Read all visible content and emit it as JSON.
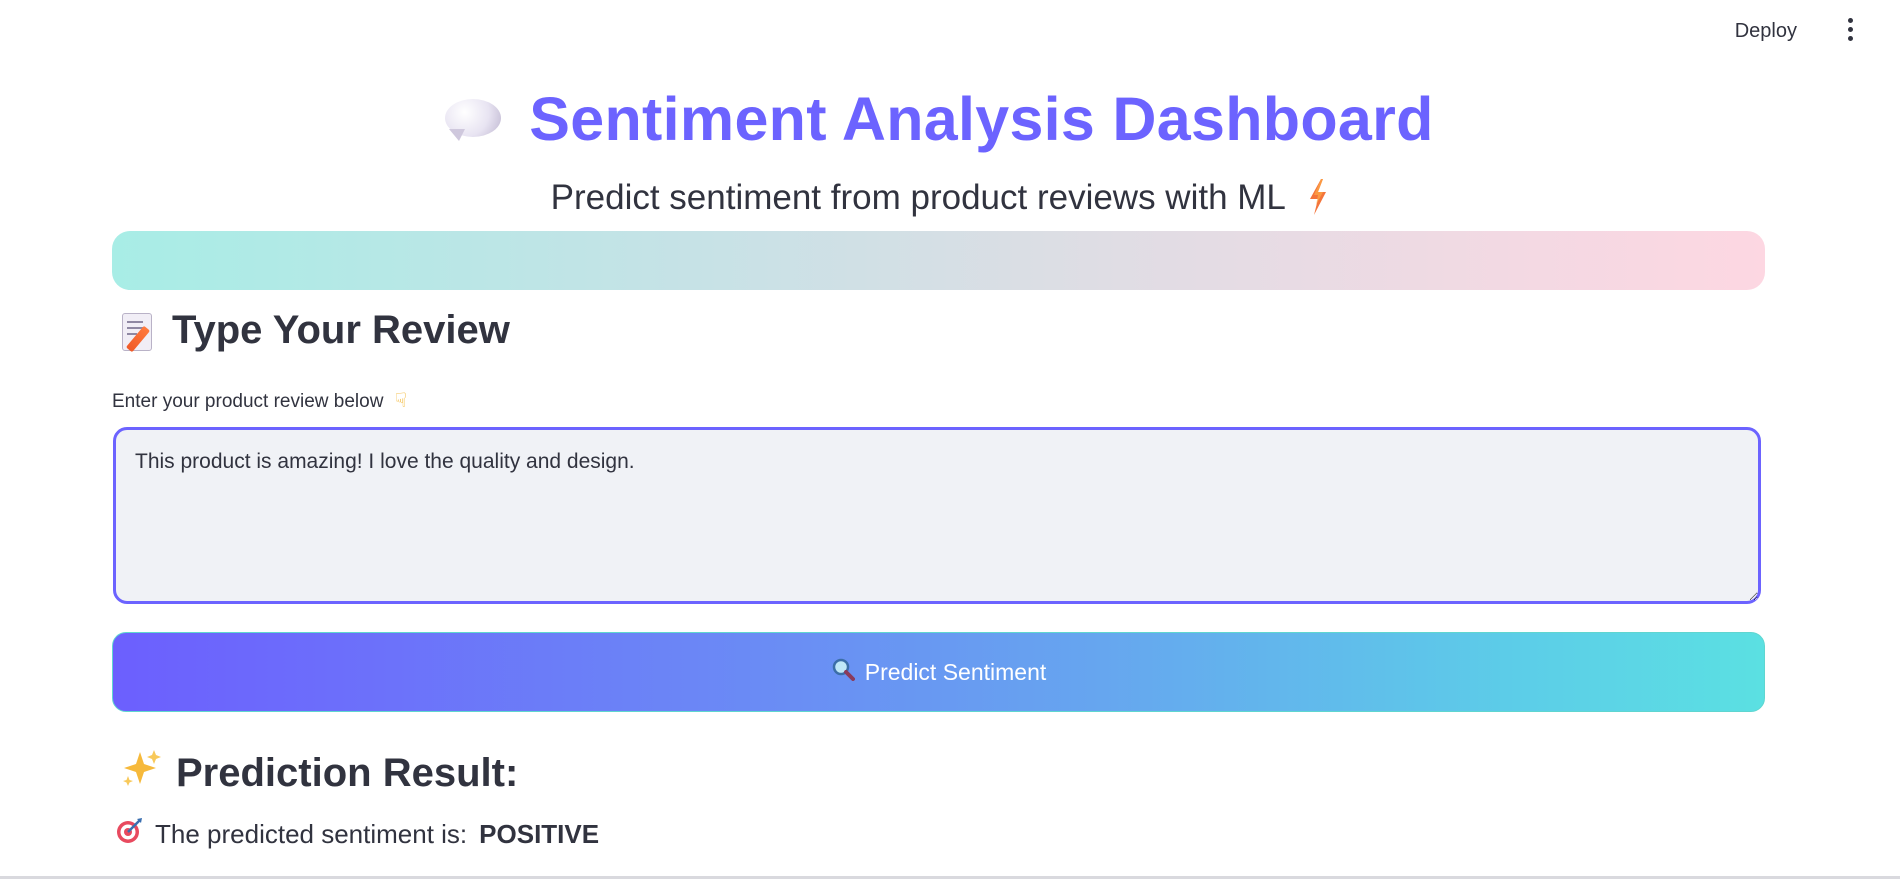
{
  "header": {
    "deploy_label": "Deploy",
    "menu_icon": "kebab-menu-icon"
  },
  "hero": {
    "title": "Sentiment Analysis Dashboard",
    "title_icon": "speech-bubble-icon",
    "subtitle": "Predict sentiment from product reviews with ML",
    "subtitle_icon": "lightning-icon",
    "title_color": "#6c63ff"
  },
  "banner": {
    "gradient_start": "#a8ede6",
    "gradient_end": "#fdd7e2"
  },
  "review_section": {
    "heading": "Type Your Review",
    "heading_icon": "memo-icon",
    "input_label": "Enter your product review below",
    "input_label_icon": "pointing-down-icon",
    "input_value": "This product is amazing! I love the quality and design."
  },
  "predict_button": {
    "label": "Predict Sentiment",
    "icon": "magnifier-icon",
    "gradient_start": "#6c5ffe",
    "gradient_end": "#5be0e2"
  },
  "result_section": {
    "heading": "Prediction Result:",
    "heading_icon": "sparkles-icon",
    "result_prefix": "The predicted sentiment is:",
    "result_value": "POSITIVE",
    "result_icon": "target-icon"
  }
}
